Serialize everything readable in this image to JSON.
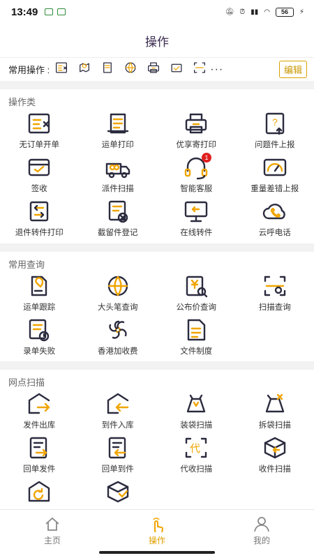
{
  "status": {
    "time": "13:49",
    "battery": "56"
  },
  "header": {
    "title": "操作"
  },
  "common": {
    "label": "常用操作 :",
    "icons": [
      "no-order-icon",
      "tracking-icon",
      "print-icon",
      "globe-icon",
      "printer-icon",
      "sign-icon",
      "scan-icon"
    ],
    "more": "···",
    "edit": "编辑"
  },
  "sections": [
    {
      "title": "操作类",
      "items": [
        {
          "label": "无订单开单",
          "icon": "no-order-icon"
        },
        {
          "label": "运单打印",
          "icon": "waybill-print-icon"
        },
        {
          "label": "优享寄打印",
          "icon": "printer-icon"
        },
        {
          "label": "问题件上报",
          "icon": "problem-report-icon"
        },
        {
          "label": "签收",
          "icon": "sign-box-icon"
        },
        {
          "label": "派件扫描",
          "icon": "delivery-truck-icon"
        },
        {
          "label": "智能客服",
          "icon": "headset-icon",
          "badge": "1"
        },
        {
          "label": "重量差错上报",
          "icon": "scale-icon"
        },
        {
          "label": "退件转件打印",
          "icon": "return-print-icon"
        },
        {
          "label": "截留件登记",
          "icon": "intercept-icon"
        },
        {
          "label": "在线转件",
          "icon": "online-transfer-icon"
        },
        {
          "label": "云呼电话",
          "icon": "cloud-phone-icon"
        }
      ]
    },
    {
      "title": "常用查询",
      "items": [
        {
          "label": "运单跟踪",
          "icon": "waybill-track-icon"
        },
        {
          "label": "大头笔查询",
          "icon": "globe-icon"
        },
        {
          "label": "公布价查询",
          "icon": "price-query-icon"
        },
        {
          "label": "扫描查询",
          "icon": "scan-query-icon"
        },
        {
          "label": "录单失败",
          "icon": "entry-failed-icon"
        },
        {
          "label": "香港加收费",
          "icon": "bauhinia-icon"
        },
        {
          "label": "文件制度",
          "icon": "document-icon"
        }
      ]
    },
    {
      "title": "网点扫描",
      "items": [
        {
          "label": "发件出库",
          "icon": "dispatch-out-icon"
        },
        {
          "label": "到件入库",
          "icon": "arrival-in-icon"
        },
        {
          "label": "装袋扫描",
          "icon": "bagging-icon"
        },
        {
          "label": "拆袋扫描",
          "icon": "unbagging-icon"
        },
        {
          "label": "回单发件",
          "icon": "receipt-send-icon"
        },
        {
          "label": "回单到件",
          "icon": "receipt-arrive-icon"
        },
        {
          "label": "代收扫描",
          "icon": "cod-scan-icon"
        },
        {
          "label": "收件扫描",
          "icon": "pickup-scan-icon"
        },
        {
          "label": "",
          "icon": "return-house-icon"
        },
        {
          "label": "",
          "icon": "box-check-icon"
        }
      ]
    }
  ],
  "tabs": [
    {
      "label": "主页",
      "icon": "home-icon",
      "active": false
    },
    {
      "label": "操作",
      "icon": "tap-hand-icon",
      "active": true
    },
    {
      "label": "我的",
      "icon": "user-icon",
      "active": false
    }
  ],
  "colors": {
    "accent": "#F0A500",
    "dark": "#2B2B3F",
    "badge": "#E02020"
  }
}
